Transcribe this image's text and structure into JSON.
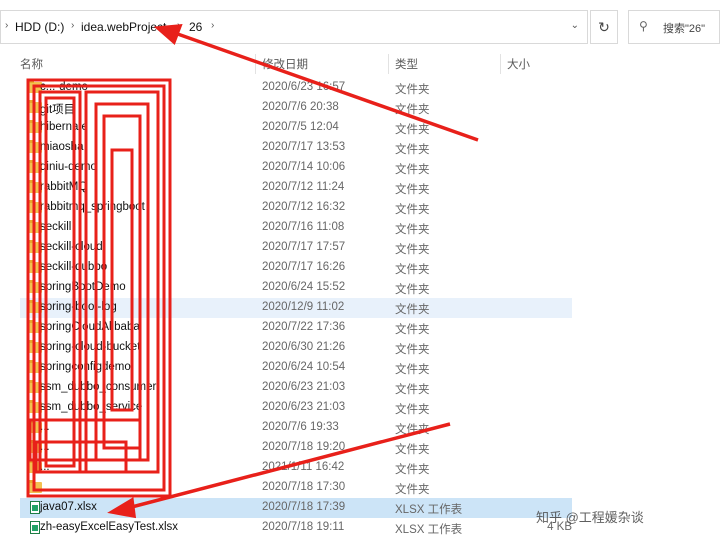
{
  "address_bar": {
    "crumbs": [
      "HDD (D:)",
      "idea.webProject",
      "26"
    ]
  },
  "search": {
    "placeholder": "搜索\"26\""
  },
  "columns": {
    "name": "名称",
    "date": "修改日期",
    "type": "类型",
    "size": "大小"
  },
  "rows": [
    {
      "name": "c...-demo",
      "date": "2020/6/23 16:57",
      "type": "文件夹",
      "size": "",
      "icon": "folder-icon"
    },
    {
      "name": "git项目",
      "date": "2020/7/6 20:38",
      "type": "文件夹",
      "size": "",
      "icon": "folder-icon"
    },
    {
      "name": "hibernate",
      "date": "2020/7/5 12:04",
      "type": "文件夹",
      "size": "",
      "icon": "folder-icon"
    },
    {
      "name": "miaosha",
      "date": "2020/7/17 13:53",
      "type": "文件夹",
      "size": "",
      "icon": "folder-icon"
    },
    {
      "name": "qiniu-demo",
      "date": "2020/7/14 10:06",
      "type": "文件夹",
      "size": "",
      "icon": "folder-icon"
    },
    {
      "name": "rabbitMQ",
      "date": "2020/7/12 11:24",
      "type": "文件夹",
      "size": "",
      "icon": "folder-icon"
    },
    {
      "name": "rabbitmq_springboot",
      "date": "2020/7/12 16:32",
      "type": "文件夹",
      "size": "",
      "icon": "folder-icon"
    },
    {
      "name": "seckill",
      "date": "2020/7/16 11:08",
      "type": "文件夹",
      "size": "",
      "icon": "folder-icon"
    },
    {
      "name": "seckill-cloud",
      "date": "2020/7/17 17:57",
      "type": "文件夹",
      "size": "",
      "icon": "folder-icon"
    },
    {
      "name": "seckill-dubbo",
      "date": "2020/7/17 16:26",
      "type": "文件夹",
      "size": "",
      "icon": "folder-icon"
    },
    {
      "name": "springBootDemo",
      "date": "2020/6/24 15:52",
      "type": "文件夹",
      "size": "",
      "icon": "folder-icon"
    },
    {
      "name": "spring-boot-log",
      "date": "2020/12/9 11:02",
      "type": "文件夹",
      "size": "",
      "icon": "folder-icon",
      "state": "hover"
    },
    {
      "name": "springCloudAlibaba",
      "date": "2020/7/22 17:36",
      "type": "文件夹",
      "size": "",
      "icon": "folder-icon"
    },
    {
      "name": "spring-cloud-bucket",
      "date": "2020/6/30 21:26",
      "type": "文件夹",
      "size": "",
      "icon": "folder-icon"
    },
    {
      "name": "springconfigdemo",
      "date": "2020/6/24 10:54",
      "type": "文件夹",
      "size": "",
      "icon": "folder-icon"
    },
    {
      "name": "ssm_dubbo_consumer",
      "date": "2020/6/23 21:03",
      "type": "文件夹",
      "size": "",
      "icon": "folder-icon"
    },
    {
      "name": "ssm_dubbo_service",
      "date": "2020/6/23 21:03",
      "type": "文件夹",
      "size": "",
      "icon": "folder-icon"
    },
    {
      "name": "...",
      "date": "2020/7/6 19:33",
      "type": "文件夹",
      "size": "",
      "icon": "folder-icon"
    },
    {
      "name": "...",
      "date": "2020/7/18 19:20",
      "type": "文件夹",
      "size": "",
      "icon": "folder-icon"
    },
    {
      "name": "...",
      "date": "2021/1/11 16:42",
      "type": "文件夹",
      "size": "",
      "icon": "folder-icon"
    },
    {
      "name": "...",
      "date": "2020/7/18 17:30",
      "type": "文件夹",
      "size": "",
      "icon": "folder-icon"
    },
    {
      "name": "java07.xlsx",
      "date": "2020/7/18 17:39",
      "type": "XLSX 工作表",
      "size": "",
      "icon": "excel-icon",
      "state": "selected"
    },
    {
      "name": "zh-easyExcelEasyTest.xlsx",
      "date": "2020/7/18 19:11",
      "type": "XLSX 工作表",
      "size": "4 KB",
      "icon": "excel-icon"
    }
  ],
  "watermark": "知乎 @工程媛杂谈",
  "colors": {
    "annotation": "#e8201a",
    "selected": "#cce4f7",
    "hover": "#e8f1fb",
    "folder": "#f3c150"
  }
}
